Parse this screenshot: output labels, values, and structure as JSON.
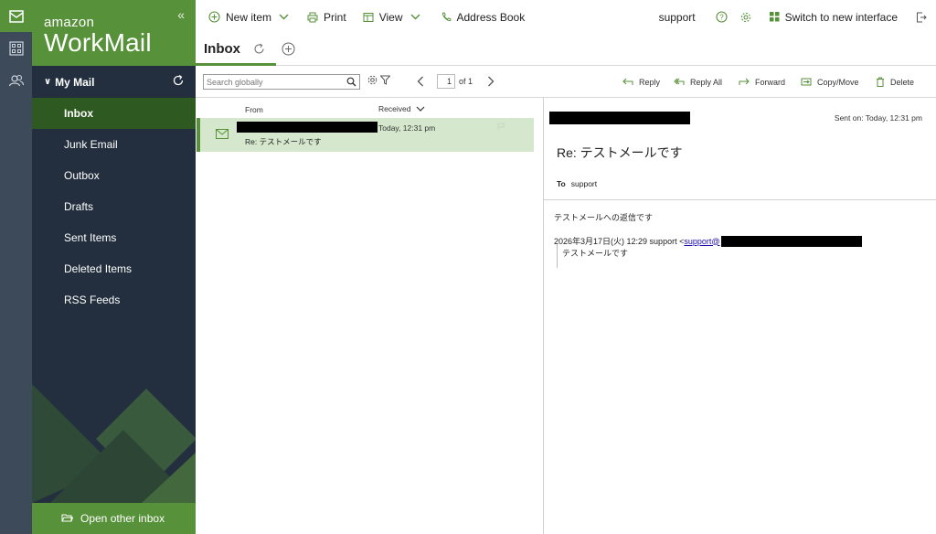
{
  "brand": {
    "line1": "amazon",
    "line2": "WorkMail"
  },
  "rail": {
    "icons": [
      "mail-icon",
      "calendar-grid-icon",
      "contacts-icon"
    ]
  },
  "nav": {
    "section_label": "My Mail",
    "folders": [
      {
        "label": "Inbox",
        "active": true
      },
      {
        "label": "Junk Email"
      },
      {
        "label": "Outbox"
      },
      {
        "label": "Drafts"
      },
      {
        "label": "Sent Items"
      },
      {
        "label": "Deleted Items"
      },
      {
        "label": "RSS Feeds"
      }
    ],
    "open_other": "Open other inbox"
  },
  "toolbar": {
    "new_item": "New item",
    "print": "Print",
    "view": "View",
    "address_book": "Address Book",
    "user": "support",
    "switch": "Switch to new interface"
  },
  "tab": {
    "label": "Inbox"
  },
  "subbar": {
    "search_placeholder": "Search globally",
    "page": "1",
    "of_pages": "of 1",
    "reply": "Reply",
    "reply_all": "Reply All",
    "forward": "Forward",
    "copy_move": "Copy/Move",
    "delete": "Delete"
  },
  "list": {
    "col_from": "From",
    "col_received": "Received",
    "messages": [
      {
        "time": "Today, 12:31 pm",
        "subject": "Re: テストメールです"
      }
    ]
  },
  "reading": {
    "sent_on": "Sent on: Today, 12:31 pm",
    "subject": "Re: テストメールです",
    "to_label": "To",
    "to_value": "support",
    "body_line": "テストメールへの返信です",
    "quote_head": "2026年3月17日(火) 12:29 support <",
    "quote_link": "support@",
    "quote_text": "テストメールです"
  },
  "colors": {
    "brand_green": "#57913a",
    "nav_dark": "#232f3e",
    "active_folder": "#2e5a22",
    "selected_row": "#d5e8cd"
  }
}
